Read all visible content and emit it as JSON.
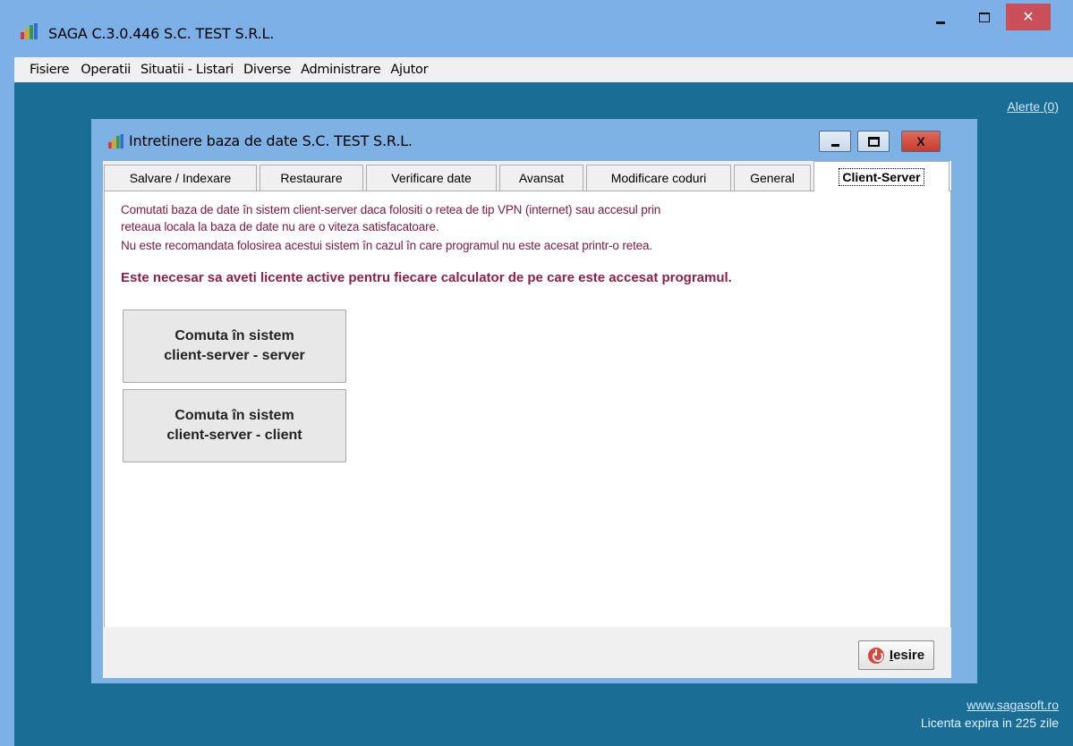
{
  "window": {
    "title": "SAGA C.3.0.446   S.C. TEST S.R.L.",
    "close_glyph": "✕"
  },
  "menu": {
    "items": [
      {
        "label": "Fisiere"
      },
      {
        "label": "Operatii"
      },
      {
        "label": "Situatii - Listari"
      },
      {
        "label": "Diverse"
      },
      {
        "label": "Administrare"
      },
      {
        "label": "Ajutor"
      }
    ]
  },
  "client": {
    "alerts": "Alerte (0)",
    "website": "www.sagasoft.ro",
    "license": "Licenta expira in 225 zile"
  },
  "dialog": {
    "title": "Intretinere baza de date S.C. TEST S.R.L.",
    "close_glyph": "X",
    "tabs": [
      {
        "label": "Salvare / Indexare"
      },
      {
        "label": "Restaurare"
      },
      {
        "label": "Verificare date"
      },
      {
        "label": "Avansat"
      },
      {
        "label": "Modificare coduri"
      },
      {
        "label": "General"
      },
      {
        "label": "Client-Server"
      }
    ],
    "active_tab": "Client-Server",
    "info": [
      "Comutati baza de date în sistem client-server daca folositi o retea de tip VPN (internet) sau accesul prin",
      "reteaua locala la baza de date nu are o viteza satisfacatoare.",
      "Nu este recomandata folosirea acestui sistem în cazul în care programul nu este acesat printr-o retea."
    ],
    "warning": "Este necesar sa aveti licente active pentru fiecare calculator de pe care este accesat programul.",
    "buttons": {
      "server_line1": "Comuta în sistem",
      "server_line2": "client-server - server",
      "client_line1": "Comuta în sistem",
      "client_line2": "client-server - client"
    },
    "exit": {
      "accel": "I",
      "rest": "esire",
      "icon": "power-icon"
    }
  },
  "colors": {
    "titlebar": "#7db0e6",
    "client_bg": "#1a6e95",
    "info_text": "#7a1a3e",
    "warning_text": "#8e1f48",
    "close_red": "#c9505a"
  }
}
